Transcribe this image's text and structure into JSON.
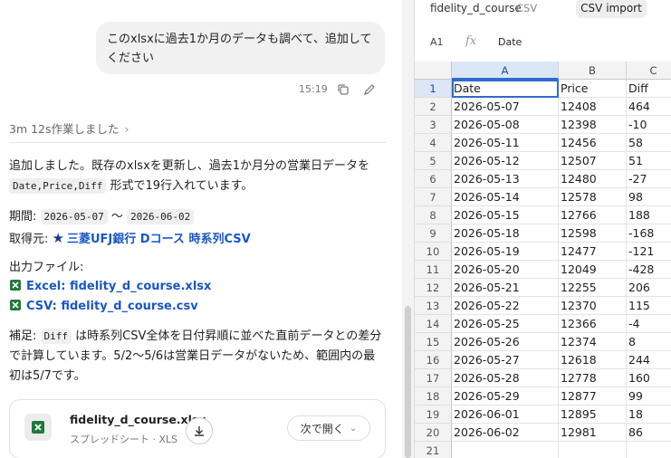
{
  "chat": {
    "user_message": "このxlsxに過去1か月のデータも調べて、追加してください",
    "time": "15:19",
    "worked_label": "3m 12s作業しました",
    "summary_part1": "追加しました。既存のxlsxを更新し、過去1か月分の営業日データを",
    "summary_code": "Date,Price,Diff",
    "summary_part2": "形式で19行入れています。",
    "period_label": "期間:",
    "period_start": "2026-05-07",
    "period_sep": "〜",
    "period_end": "2026-06-02",
    "source_label": "取得元:",
    "source_link": "三菱UFJ銀行 Dコース 時系列CSV",
    "output_label": "出力ファイル:",
    "excel_link": "Excel: fidelity_d_course.xlsx",
    "csv_link": "CSV: fidelity_d_course.csv",
    "note_label": "補足:",
    "note_code": "Diff",
    "note_text": "は時系列CSV全体を日付昇順に並べた直前データとの差分で計算しています。5/2〜5/6は営業日データがないため、範囲内の最初は5/7です。",
    "card_name": "fidelity_d_course.xlsx",
    "card_sub": "スプレッドシート · XLS",
    "card_open": "次で開く"
  },
  "sheet": {
    "file_name": "fidelity_d_course",
    "file_type": "CSV",
    "import_button": "CSV import",
    "cell_ref": "A1",
    "fx": "fx",
    "formula_value": "Date",
    "columns": [
      "A",
      "B",
      "C"
    ],
    "rows": [
      [
        "Date",
        "Price",
        "Diff"
      ],
      [
        "2026-05-07",
        "12408",
        "464"
      ],
      [
        "2026-05-08",
        "12398",
        "-10"
      ],
      [
        "2026-05-11",
        "12456",
        "58"
      ],
      [
        "2026-05-12",
        "12507",
        "51"
      ],
      [
        "2026-05-13",
        "12480",
        "-27"
      ],
      [
        "2026-05-14",
        "12578",
        "98"
      ],
      [
        "2026-05-15",
        "12766",
        "188"
      ],
      [
        "2026-05-18",
        "12598",
        "-168"
      ],
      [
        "2026-05-19",
        "12477",
        "-121"
      ],
      [
        "2026-05-20",
        "12049",
        "-428"
      ],
      [
        "2026-05-21",
        "12255",
        "206"
      ],
      [
        "2026-05-22",
        "12370",
        "115"
      ],
      [
        "2026-05-25",
        "12366",
        "-4"
      ],
      [
        "2026-05-26",
        "12374",
        "8"
      ],
      [
        "2026-05-27",
        "12618",
        "244"
      ],
      [
        "2026-05-28",
        "12778",
        "160"
      ],
      [
        "2026-05-29",
        "12877",
        "99"
      ],
      [
        "2026-06-01",
        "12895",
        "18"
      ],
      [
        "2026-06-02",
        "12981",
        "86"
      ],
      [
        "",
        "",
        ""
      ]
    ]
  }
}
